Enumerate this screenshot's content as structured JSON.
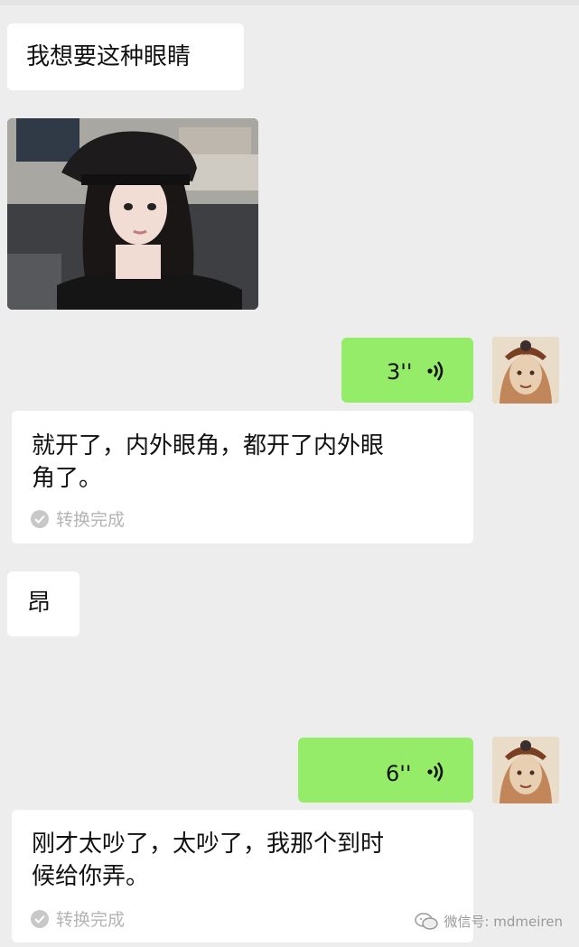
{
  "messages": {
    "m1": {
      "text": "我想要这种眼睛"
    },
    "m3": {
      "duration": "3''"
    },
    "m4": {
      "line1": "就开了，内外眼角，都开了内外眼",
      "line2": "角了。",
      "status": "转换完成"
    },
    "m5": {
      "text": "昂"
    },
    "m6": {
      "duration": "6''"
    },
    "m7": {
      "line1": "刚才太吵了，太吵了，我那个到时",
      "line2": "候给你弄。",
      "status": "转换完成"
    }
  },
  "watermark": {
    "text": "微信号: mdmeiren"
  },
  "icons": {
    "voice": "voice-wave-icon",
    "check": "check-circle-icon",
    "wechat": "wechat-logo-icon"
  },
  "colors": {
    "background": "#ededed",
    "bubble_white": "#ffffff",
    "bubble_green": "#95ec69"
  }
}
